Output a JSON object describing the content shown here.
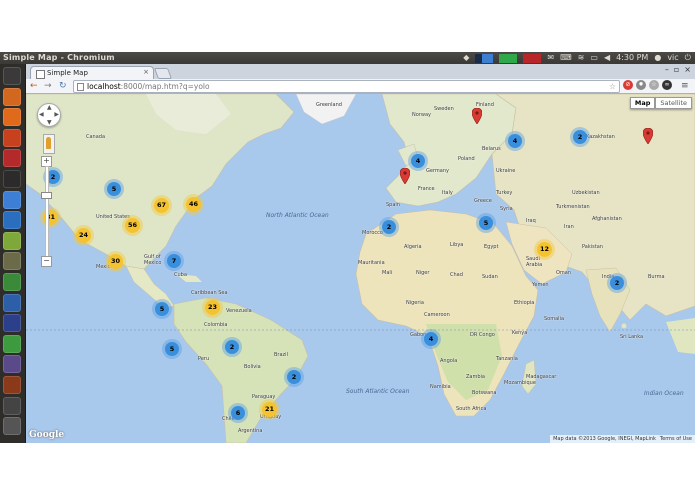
{
  "panel": {
    "window_title": "Simple Map - Chromium",
    "time": "4:30 PM",
    "user": "vic",
    "icons": [
      "dropbox-icon",
      "network-meter-icon",
      "cpu-meter-icon",
      "memory-meter-icon",
      "mail-icon",
      "keyboard-icon",
      "wifi-icon",
      "battery-icon",
      "volume-icon",
      "user-icon",
      "power-icon"
    ]
  },
  "launcher": {
    "items": [
      {
        "icon": "dash-icon",
        "color": "#3a3a3a"
      },
      {
        "icon": "files-icon",
        "color": "#d2681f"
      },
      {
        "icon": "firefox-icon",
        "color": "#e06a1b"
      },
      {
        "icon": "ubuntu-software-icon",
        "color": "#c8411f"
      },
      {
        "icon": "settings-icon",
        "color": "#b42a2a"
      },
      {
        "icon": "terminal-icon",
        "color": "#2b2b2b"
      },
      {
        "icon": "chromium-icon",
        "color": "#3d7fd4"
      },
      {
        "icon": "editor-icon",
        "color": "#2a6fbf"
      },
      {
        "icon": "android-icon",
        "color": "#7fa83b"
      },
      {
        "icon": "gimp-icon",
        "color": "#6b6b4a"
      },
      {
        "icon": "network-icon",
        "color": "#3a8a3a"
      },
      {
        "icon": "app-icon",
        "color": "#2d5fa8"
      },
      {
        "icon": "eclipse-icon",
        "color": "#2c3f8a"
      },
      {
        "icon": "spreadsheet-icon",
        "color": "#3e9a3e"
      },
      {
        "icon": "drive-icon",
        "color": "#5a4a8a"
      },
      {
        "icon": "screenshot-icon",
        "color": "#8a3a1a"
      },
      {
        "icon": "workspace-icon",
        "color": "#444444"
      },
      {
        "icon": "trash-icon",
        "color": "#555555"
      }
    ]
  },
  "browser": {
    "tab_title": "Simple Map",
    "url_host": "localhost",
    "url_rest": ":8000/map.htm?q=yolo",
    "nav_back": "←",
    "nav_forward": "→",
    "nav_reload": "↻",
    "tab_close": "×",
    "star": "☆",
    "menu": "≡"
  },
  "map": {
    "map_type_options": [
      "Map",
      "Satellite"
    ],
    "selected_map_type": "Map",
    "zoom_in": "+",
    "zoom_out": "−",
    "google_logo": "Google",
    "attribution": "Map data ©2013 Google, INEGI, MapLink",
    "terms": "Terms of Use",
    "accent_blue": "#3a8fdc",
    "accent_yellow": "#f5c230",
    "pin_color": "#d93a33",
    "oceans": [
      {
        "name": "North\nAtlantic\nOcean"
      },
      {
        "name": "South\nAtlantic\nOcean"
      },
      {
        "name": "Indian\nOcean"
      }
    ],
    "places": [
      "Canada",
      "United States",
      "Mexico",
      "Cuba",
      "Gulf of\nMexico",
      "Caribbean Sea",
      "Venezuela",
      "Colombia",
      "Peru",
      "Bolivia",
      "Brazil",
      "Chile",
      "Paraguay",
      "Argentina",
      "Uruguay",
      "Finland",
      "Sweden",
      "Norway",
      "Belarus",
      "Ukraine",
      "Poland",
      "Germany",
      "France",
      "Spain",
      "Italy",
      "Turkey",
      "Greece",
      "Morocco",
      "Algeria",
      "Libya",
      "Egypt",
      "Mali",
      "Niger",
      "Chad",
      "Sudan",
      "Nigeria",
      "Ethiopia",
      "Kenya",
      "DR Congo",
      "Angola",
      "Namibia",
      "South Africa",
      "Tanzania",
      "Mozambique",
      "Madagascar",
      "Saudi\nArabia",
      "Iran",
      "Iraq",
      "Afghanistan",
      "Pakistan",
      "India",
      "Kazakhstan",
      "Yemen",
      "Oman",
      "Somalia",
      "Mauritania",
      "Zambia",
      "Sri Lanka",
      "Greenland",
      "Botswana",
      "Syria",
      "Uzbekistan",
      "Turkmenistan",
      "Cameroon",
      "Gabon",
      "Burma"
    ],
    "clusters": [
      {
        "label": "2",
        "kind": "blue"
      },
      {
        "label": "5",
        "kind": "blue"
      },
      {
        "label": "31",
        "kind": "yellow"
      },
      {
        "label": "67",
        "kind": "yellow"
      },
      {
        "label": "46",
        "kind": "yellow"
      },
      {
        "label": "56",
        "kind": "yellow"
      },
      {
        "label": "24",
        "kind": "yellow"
      },
      {
        "label": "30",
        "kind": "yellow"
      },
      {
        "label": "7",
        "kind": "blue"
      },
      {
        "label": "23",
        "kind": "yellow"
      },
      {
        "label": "5",
        "kind": "blue"
      },
      {
        "label": "5",
        "kind": "blue"
      },
      {
        "label": "2",
        "kind": "blue"
      },
      {
        "label": "2",
        "kind": "blue"
      },
      {
        "label": "6",
        "kind": "blue"
      },
      {
        "label": "21",
        "kind": "yellow"
      },
      {
        "label": "4",
        "kind": "blue"
      },
      {
        "label": "4",
        "kind": "blue"
      },
      {
        "label": "2",
        "kind": "blue"
      },
      {
        "label": "2",
        "kind": "blue"
      },
      {
        "label": "5",
        "kind": "blue"
      },
      {
        "label": "12",
        "kind": "yellow"
      },
      {
        "label": "2",
        "kind": "blue"
      },
      {
        "label": "4",
        "kind": "blue"
      }
    ]
  }
}
